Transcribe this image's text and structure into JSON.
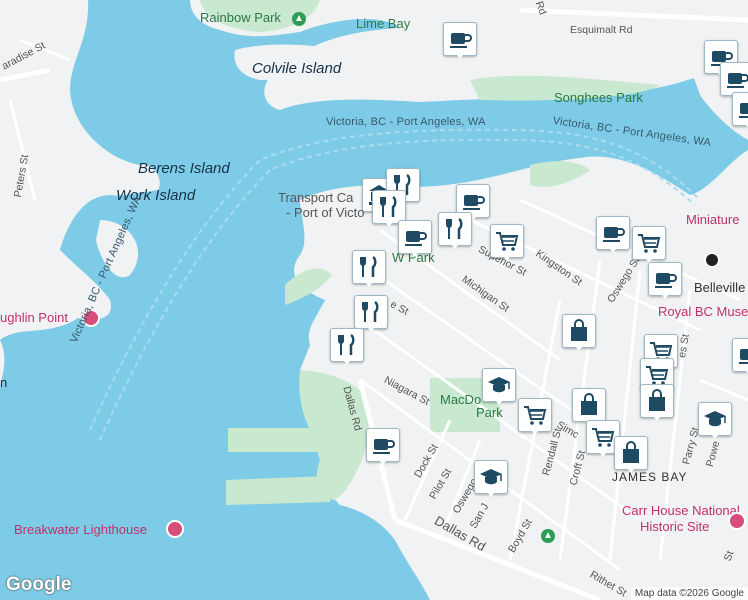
{
  "map": {
    "labels": {
      "rainbow_park": "Rainbow Park",
      "lime_bay": "Lime Bay",
      "colvile_island": "Colvile Island",
      "songhees_park": "Songhees Park",
      "berens_island": "Berens Island",
      "work_island": "Work Island",
      "mclaughlin_point": "ughlin Point",
      "transport_canada_1": "Transport Ca",
      "transport_canada_2": "- Port of Victo",
      "wharf_park": "W   Park",
      "miniature": "Miniature",
      "belleville": "Belleville",
      "royal_bc_museum": "Royal BC Muse",
      "macdonald_park_1": "MacDo",
      "macdonald_park_2": "Park",
      "james_bay": "JAMES BAY",
      "carr_house_1": "Carr House National",
      "carr_house_2": "Historic Site",
      "breakwater_lighthouse": "Breakwater Lighthouse",
      "left_edge_n": "n"
    },
    "ferry_routes": {
      "route_top": "Victoria, BC - Port Angeles, WA",
      "route_top_2": "Victoria, BC - Port Angeles, WA",
      "route_side": "Victoria, BC - Port Angeles, WA",
      "route_right": "Victoria, BC - Port Angeles, WA"
    },
    "streets": {
      "paradise_st": "aradise St",
      "peters_st": "Peters St",
      "esquimalt_rd": "Esquimalt Rd",
      "supe_rd": "Rd",
      "superior_st": "Superior St",
      "kingston_st": "Kingston St",
      "michigan_st": "Michigan St",
      "oswego_st_top": "Oswego St",
      "ae_st": "e St",
      "niagara_st": "Niagara St",
      "dallas_rd_v": "Dallas Rd",
      "dallas_rd_h": "Dallas Rd",
      "dock_st": "Dock St",
      "pilot_st": "Pilot St",
      "oswego_st": "Oswego",
      "san_j": "San J",
      "boyd_st": "Boyd St",
      "rendall_st": "Rendall St",
      "croft_st": "Croft St",
      "simc": "Simc",
      "parry_st": "Parry St",
      "powe": "Powe",
      "rithet_st": "Rithet St",
      "es_st": "es St",
      "st_right": "St"
    },
    "markers": [
      {
        "kind": "cafe",
        "icon": "coffee-cup-icon"
      },
      {
        "kind": "bank",
        "icon": "bank-icon"
      },
      {
        "kind": "restaurant",
        "icon": "fork-knife-icon"
      },
      {
        "kind": "restaurant",
        "icon": "fork-knife-icon"
      },
      {
        "kind": "cafe",
        "icon": "coffee-cup-icon"
      },
      {
        "kind": "cafe",
        "icon": "coffee-cup-icon"
      },
      {
        "kind": "restaurant",
        "icon": "fork-knife-icon"
      },
      {
        "kind": "grocery",
        "icon": "shopping-cart-icon"
      },
      {
        "kind": "restaurant",
        "icon": "fork-knife-icon"
      },
      {
        "kind": "restaurant",
        "icon": "fork-knife-icon"
      },
      {
        "kind": "restaurant",
        "icon": "fork-knife-icon"
      },
      {
        "kind": "shop",
        "icon": "shopping-bag-icon"
      },
      {
        "kind": "school",
        "icon": "graduation-cap-icon"
      },
      {
        "kind": "grocery",
        "icon": "shopping-cart-icon"
      },
      {
        "kind": "cafe",
        "icon": "coffee-cup-icon"
      },
      {
        "kind": "school",
        "icon": "graduation-cap-icon"
      },
      {
        "kind": "cafe",
        "icon": "coffee-cup-icon"
      },
      {
        "kind": "grocery",
        "icon": "shopping-cart-icon"
      },
      {
        "kind": "cafe",
        "icon": "coffee-cup-icon"
      },
      {
        "kind": "cafe",
        "icon": "coffee-cup-icon"
      },
      {
        "kind": "shop",
        "icon": "shopping-bag-icon"
      },
      {
        "kind": "grocery",
        "icon": "shopping-cart-icon"
      },
      {
        "kind": "grocery",
        "icon": "shopping-cart-icon"
      },
      {
        "kind": "shop",
        "icon": "shopping-bag-icon"
      },
      {
        "kind": "grocery",
        "icon": "shopping-cart-icon"
      },
      {
        "kind": "shop",
        "icon": "shopping-bag-icon"
      },
      {
        "kind": "school",
        "icon": "graduation-cap-icon"
      },
      {
        "kind": "cafe",
        "icon": "coffee-cup-icon"
      },
      {
        "kind": "cafe",
        "icon": "coffee-cup-icon"
      },
      {
        "kind": "cafe",
        "icon": "coffee-cup-icon"
      }
    ],
    "google_logo": "Google",
    "attribution": "Map data ©2026 Google",
    "colors": {
      "water": "#7dcbe6",
      "land": "#f1f2f3",
      "park": "#c8e8cf",
      "marker_icon": "#1f4a63"
    }
  }
}
